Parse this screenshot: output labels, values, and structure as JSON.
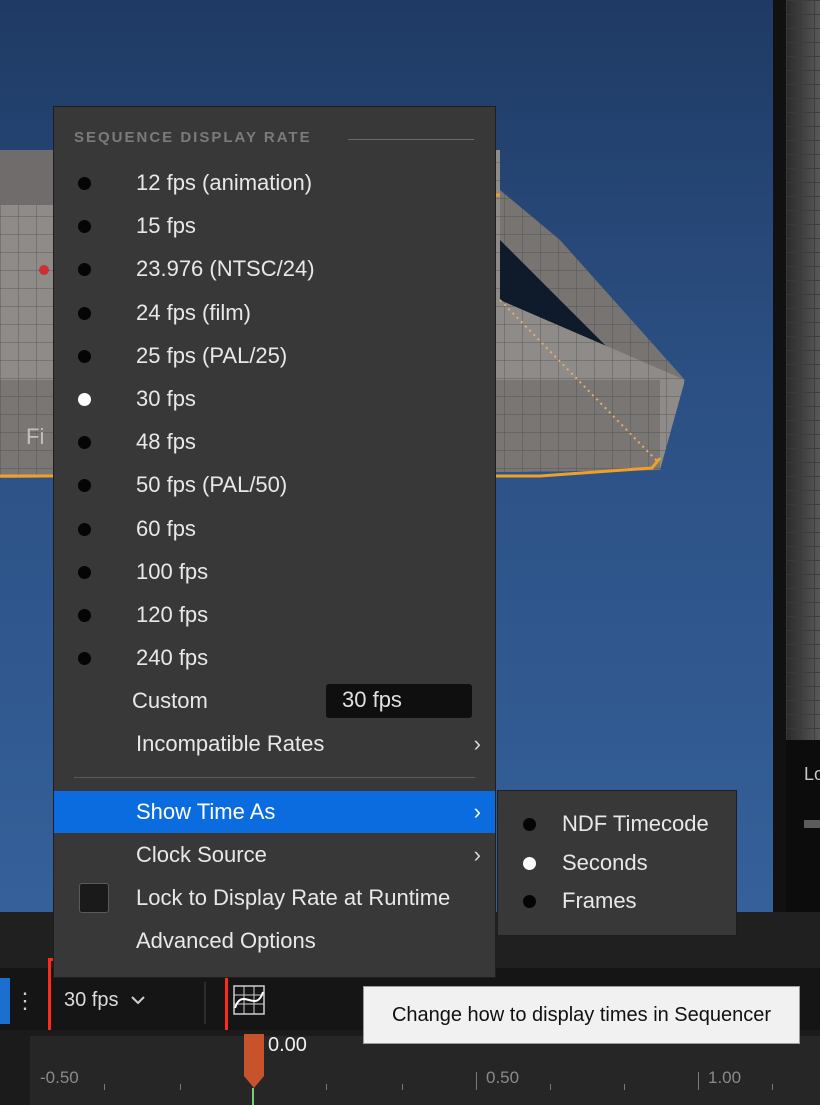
{
  "menu": {
    "section_title": "SEQUENCE DISPLAY RATE",
    "rates": [
      {
        "label": "12 fps (animation)",
        "selected": false
      },
      {
        "label": "15 fps",
        "selected": false
      },
      {
        "label": "23.976 (NTSC/24)",
        "selected": false
      },
      {
        "label": "24 fps (film)",
        "selected": false
      },
      {
        "label": "25 fps (PAL/25)",
        "selected": false
      },
      {
        "label": "30 fps",
        "selected": true
      },
      {
        "label": "48 fps",
        "selected": false
      },
      {
        "label": "50 fps (PAL/50)",
        "selected": false
      },
      {
        "label": "60 fps",
        "selected": false
      },
      {
        "label": "100 fps",
        "selected": false
      },
      {
        "label": "120 fps",
        "selected": false
      },
      {
        "label": "240 fps",
        "selected": false
      }
    ],
    "custom_label": "Custom",
    "custom_value": "30 fps",
    "incompatible_label": "Incompatible Rates",
    "show_time_as_label": "Show Time As",
    "clock_source_label": "Clock Source",
    "lock_label": "Lock to Display Rate at Runtime",
    "lock_checked": false,
    "advanced_label": "Advanced Options",
    "highlight_color": "#0b6ce0"
  },
  "submenu": {
    "items": [
      {
        "label": "NDF Timecode",
        "selected": false
      },
      {
        "label": "Seconds",
        "selected": true
      },
      {
        "label": "Frames",
        "selected": false
      }
    ]
  },
  "toolbar": {
    "fps_value": "30 fps",
    "tooltip": "Change how to display times in Sequencer",
    "highlight_box_color": "#ff2a1c"
  },
  "timeline": {
    "playhead_value": "0.00",
    "ticks": [
      "-0.50",
      "0.50",
      "1.00"
    ]
  },
  "viewport": {
    "floor_text": "Fi",
    "right_label": "Lo"
  }
}
